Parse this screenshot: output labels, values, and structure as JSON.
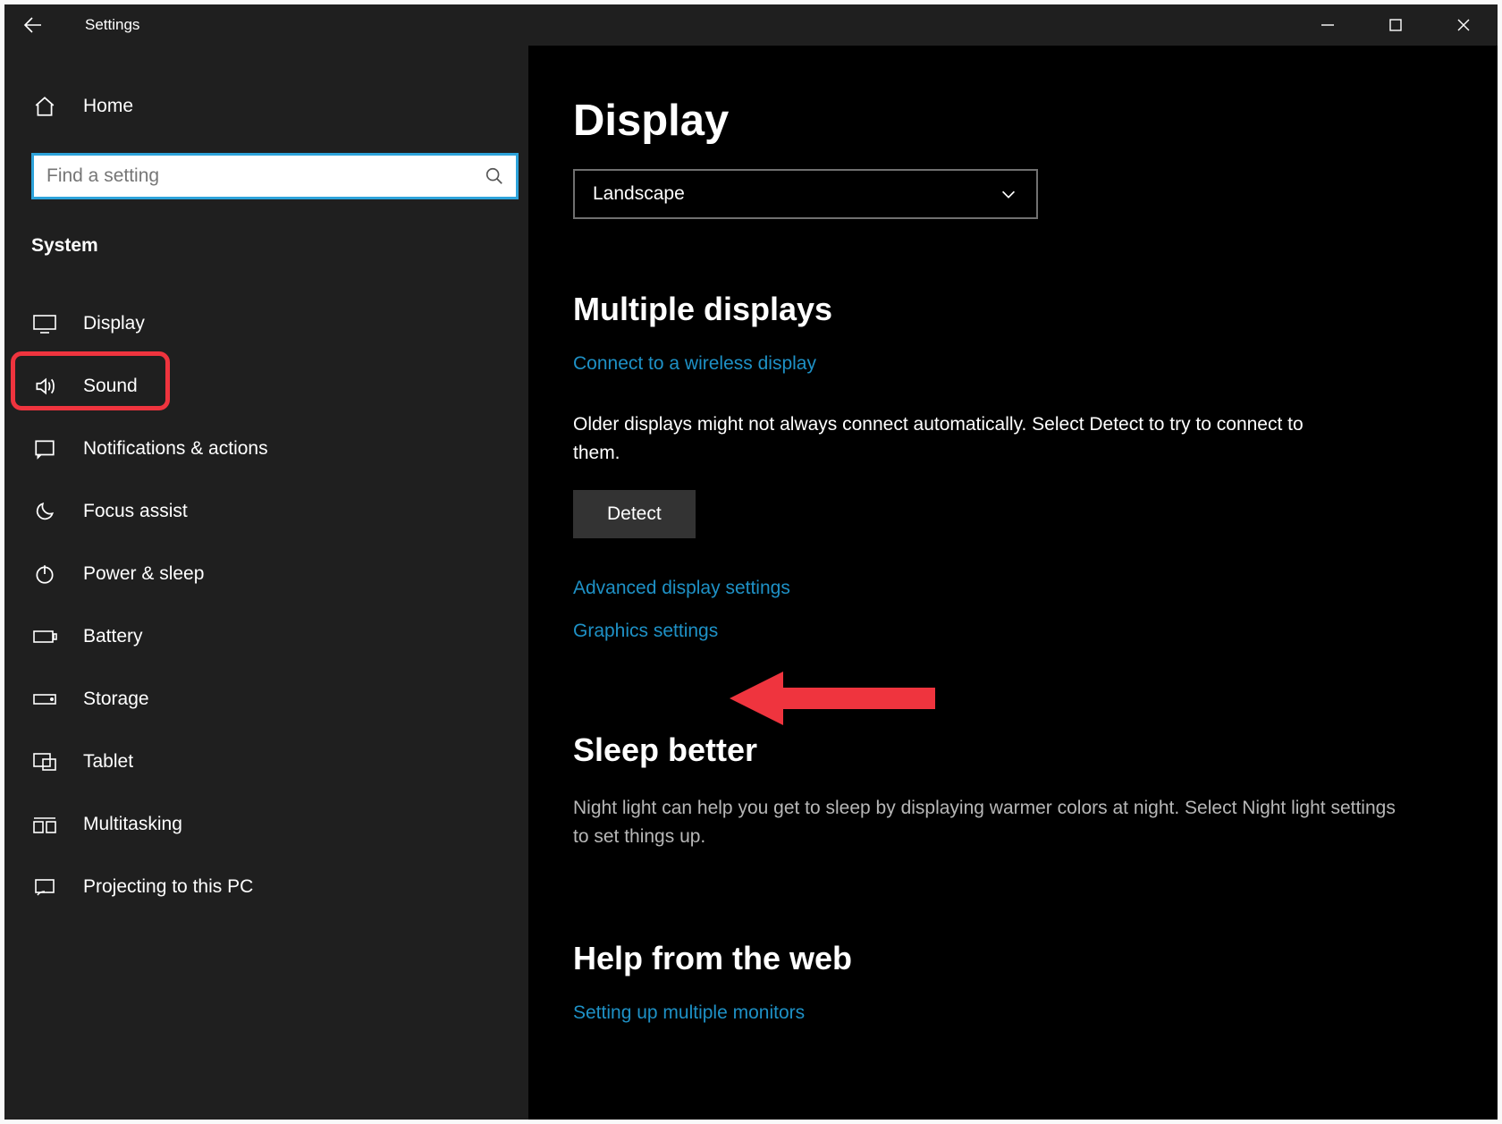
{
  "window": {
    "title": "Settings"
  },
  "sidebar": {
    "home_label": "Home",
    "search_placeholder": "Find a setting",
    "category_label": "System",
    "items": [
      {
        "label": "Display"
      },
      {
        "label": "Sound"
      },
      {
        "label": "Notifications & actions"
      },
      {
        "label": "Focus assist"
      },
      {
        "label": "Power & sleep"
      },
      {
        "label": "Battery"
      },
      {
        "label": "Storage"
      },
      {
        "label": "Tablet"
      },
      {
        "label": "Multitasking"
      },
      {
        "label": "Projecting to this PC"
      }
    ]
  },
  "main": {
    "page_title": "Display",
    "orientation_dropdown": {
      "selected": "Landscape"
    },
    "multiple_displays": {
      "heading": "Multiple displays",
      "connect_link": "Connect to a wireless display",
      "detect_hint": "Older displays might not always connect automatically. Select Detect to try to connect to them.",
      "detect_button": "Detect",
      "advanced_link": "Advanced display settings",
      "graphics_link": "Graphics settings"
    },
    "sleep_better": {
      "heading": "Sleep better",
      "body": "Night light can help you get to sleep by displaying warmer colors at night. Select Night light settings to set things up."
    },
    "help": {
      "heading": "Help from the web",
      "link1": "Setting up multiple monitors"
    }
  }
}
